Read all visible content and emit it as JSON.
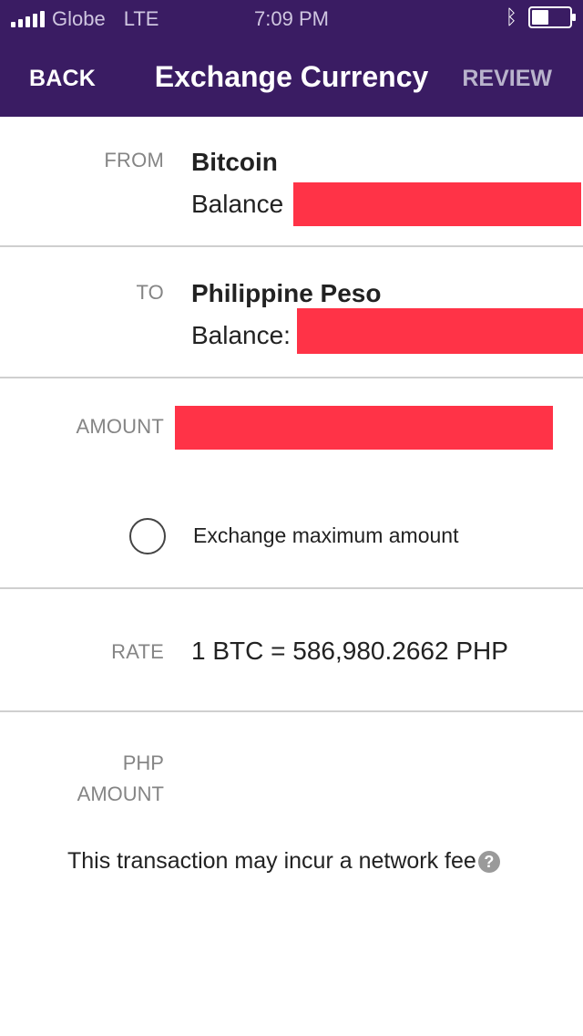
{
  "status_bar": {
    "carrier": "Globe",
    "network": "LTE",
    "time": "7:09 PM",
    "icons": [
      "signal-icon",
      "bluetooth-icon",
      "battery-icon"
    ]
  },
  "nav": {
    "back_label": "BACK",
    "title": "Exchange Currency",
    "review_label": "REVIEW"
  },
  "from": {
    "label": "FROM",
    "currency": "Bitcoin",
    "balance_label": "Balance"
  },
  "to": {
    "label": "TO",
    "currency": "Philippine Peso",
    "balance_label": "Balance:"
  },
  "amount": {
    "label": "AMOUNT",
    "max_option_label": "Exchange maximum amount",
    "max_selected": false
  },
  "rate": {
    "label": "RATE",
    "value": "1 BTC = 586,980.2662 PHP"
  },
  "php_amount": {
    "label_line1": "PHP",
    "label_line2": "AMOUNT"
  },
  "fee_note": {
    "text": "This transaction may incur a network fee",
    "icon": "help-icon"
  },
  "colors": {
    "header_bg": "#3a1c63",
    "redaction": "#ff3347",
    "label_gray": "#858585",
    "divider": "#cfcfcf"
  }
}
